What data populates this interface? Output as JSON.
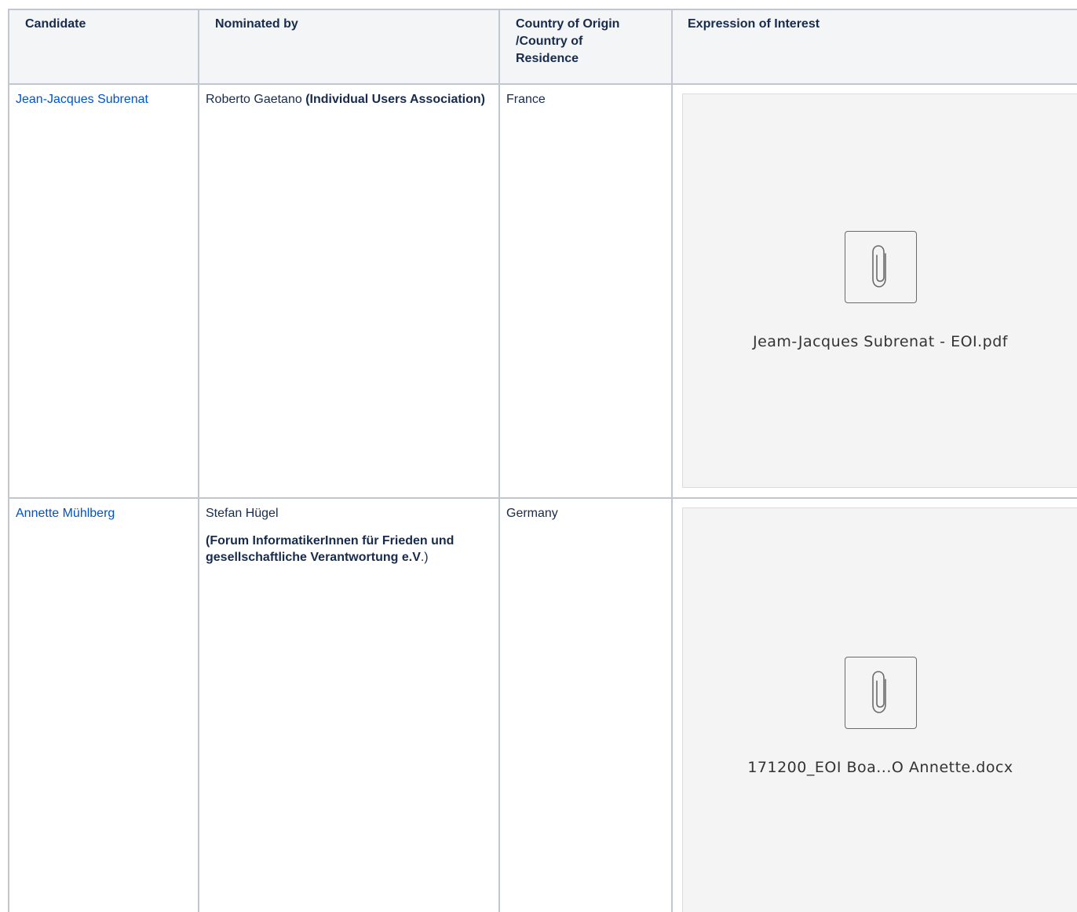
{
  "table": {
    "headers": {
      "candidate": "Candidate",
      "nominated_by": "Nominated by",
      "country": "Country of Origin /Country of Residence",
      "eoi": "Expression of Interest"
    },
    "rows": [
      {
        "candidate": "Jean-Jacques Subrenat",
        "nominator_name": "Roberto Gaetano ",
        "nominator_org": "(Individual Users Association)",
        "country": "France",
        "attachment": {
          "icon": "paperclip-icon",
          "filename": "Jeam-Jacques Subrenat - EOI.pdf"
        }
      },
      {
        "candidate": "Annette Mühlberg",
        "nominator_name": "Stefan Hügel",
        "nominator_org": "(Forum InformatikerInnen für Frieden und gesellschaftliche Verantwortung e.V",
        "nominator_org_suffix": ".)",
        "country": "Germany",
        "attachment": {
          "icon": "paperclip-icon",
          "filename": "171200_EOI Boa...O Annette.docx"
        }
      }
    ]
  },
  "colors": {
    "link": "#0052cc",
    "header_bg": "#f4f5f7",
    "border": "#c1c7d0",
    "preview_bg": "#f4f4f4"
  }
}
